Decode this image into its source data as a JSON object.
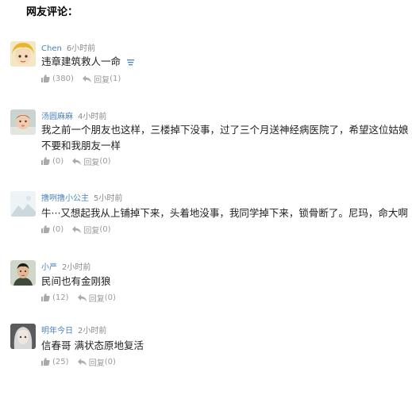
{
  "section": {
    "title": "网友评论："
  },
  "colors": {
    "username": "#4b83b9",
    "muted": "#9a9a9a"
  },
  "comments": [
    {
      "username": "Chen",
      "time": "6小时前",
      "text": "违章建筑救人一命",
      "likes": "(380)",
      "reply_label": "回复",
      "reply_count": "(1)",
      "has_expand_icon": true
    },
    {
      "username": "汤圆麻麻",
      "time": "4小时前",
      "text": "我之前一个朋友也这样，三楼掉下没事，过了三个月送神经病医院了，希望这位姑娘不要和我朋友一样",
      "likes": "(0)",
      "reply_label": "回复",
      "reply_count": "(0)"
    },
    {
      "username": "撸咧撸小公主",
      "time": "5小时前",
      "text": "牛···又想起我从上铺掉下来，头着地没事，我同学掉下来，锁骨断了。尼玛，命大啊",
      "likes": "(0)",
      "reply_label": "回复",
      "reply_count": "(0)"
    },
    {
      "username": "小严",
      "time": "2小时前",
      "text": "民间也有金刚狼",
      "likes": "(12)",
      "reply_label": "回复",
      "reply_count": "(0)"
    },
    {
      "username": "明年今日",
      "time": "2小时前",
      "text": "信春哥 满状态原地复活",
      "likes": "(25)",
      "reply_label": "回复",
      "reply_count": "(0)"
    }
  ]
}
